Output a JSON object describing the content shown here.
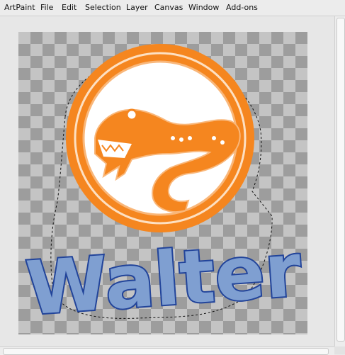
{
  "menubar": {
    "items": [
      {
        "label": "ArtPaint"
      },
      {
        "label": "File"
      },
      {
        "label": "Edit"
      },
      {
        "label": "Selection"
      },
      {
        "label": "Layer"
      },
      {
        "label": "Canvas"
      },
      {
        "label": "Window"
      },
      {
        "label": "Add-ons"
      }
    ]
  },
  "canvas": {
    "logo_text": "Walter",
    "colors": {
      "accent_orange": "#f5861f",
      "light_orange": "#f9b77a",
      "text_fill": "#7f9fd1",
      "text_outline": "#22449a",
      "checker_dark": "#9d9d9d",
      "checker_light": "#c4c4c4"
    },
    "icons": {
      "logo": "salamander-logo-icon"
    }
  }
}
